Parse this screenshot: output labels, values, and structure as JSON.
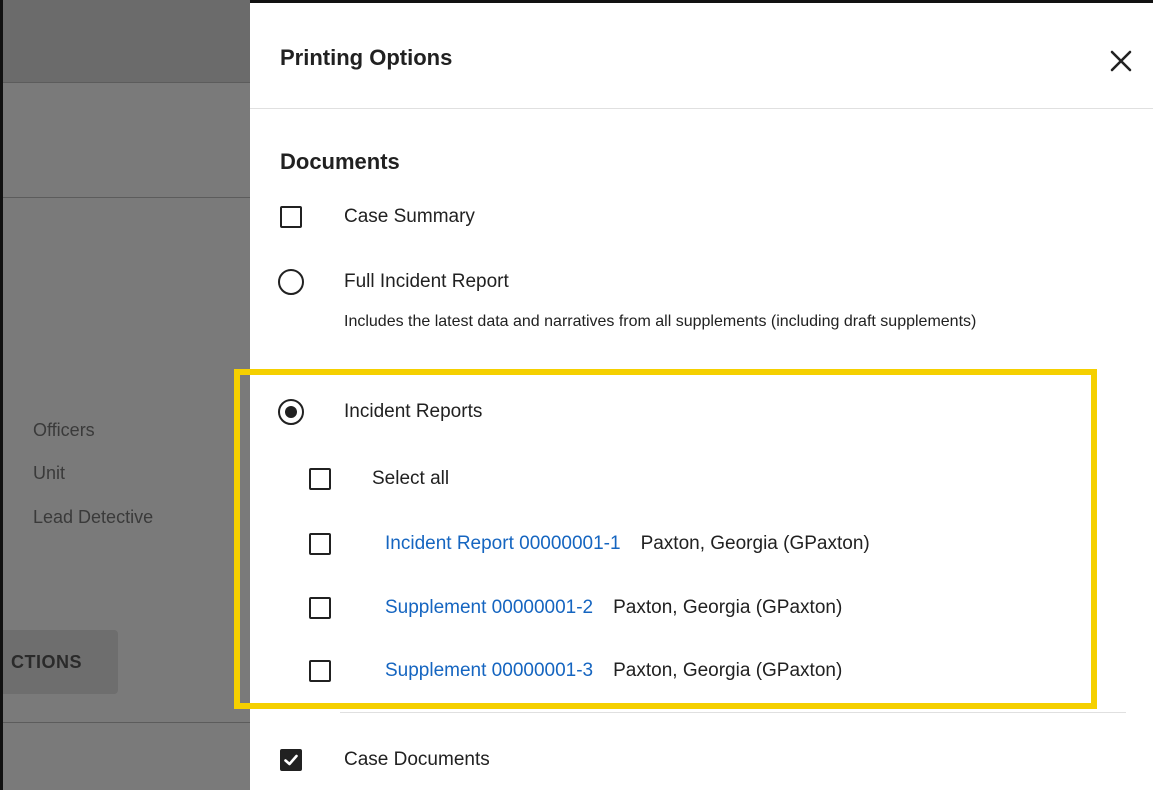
{
  "background": {
    "labels": [
      "Officers",
      "Unit",
      "Lead Detective"
    ],
    "button_label": "CTIONS"
  },
  "dialog": {
    "title": "Printing Options",
    "close_icon": "close-icon",
    "section_title": "Documents",
    "options": {
      "case_summary": {
        "label": "Case Summary",
        "checked": false
      },
      "full_incident_report": {
        "label": "Full Incident Report",
        "description": "Includes the latest data and narratives from all supplements (including draft supplements)",
        "selected": false
      },
      "incident_reports": {
        "label": "Incident Reports",
        "selected": true,
        "select_all_label": "Select all",
        "items": [
          {
            "link": "Incident Report 00000001-1",
            "owner": "Paxton, Georgia (GPaxton)",
            "checked": false
          },
          {
            "link": "Supplement 00000001-2",
            "owner": "Paxton, Georgia (GPaxton)",
            "checked": false
          },
          {
            "link": "Supplement 00000001-3",
            "owner": "Paxton, Georgia (GPaxton)",
            "checked": false
          }
        ]
      },
      "case_documents": {
        "label": "Case Documents",
        "checked": true
      }
    }
  },
  "colors": {
    "highlight": "#f5d000",
    "link": "#1565c0",
    "backdrop": "#7a7a7a"
  }
}
